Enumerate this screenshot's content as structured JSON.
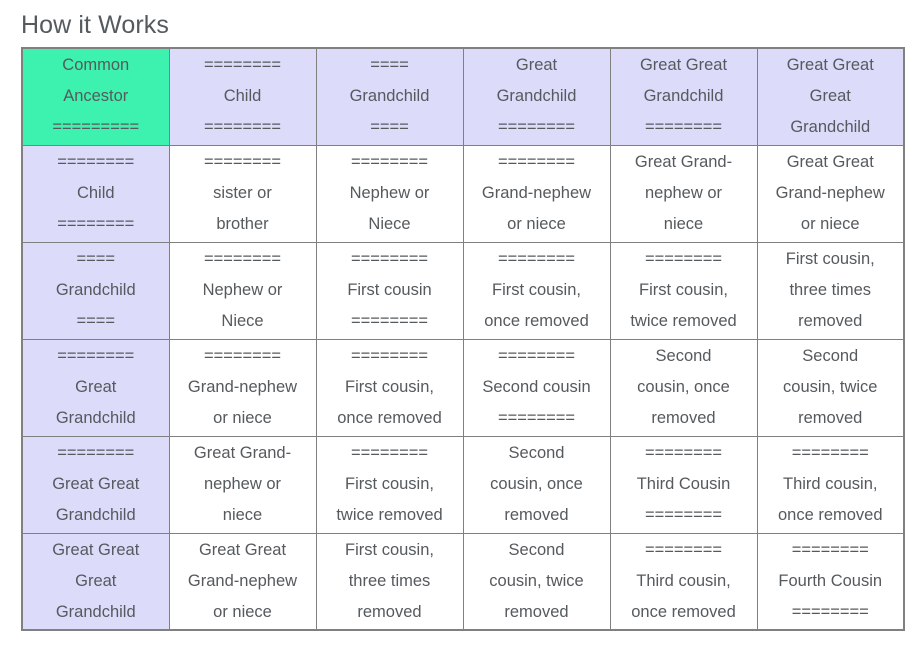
{
  "page": {
    "title": "How it Works"
  },
  "colors": {
    "anchor_cell": "#3df2ae",
    "header_cell": "#dcdcfa",
    "side_cell": "#dcdcfa",
    "body_cell": "#ffffff",
    "border": "#808080",
    "text": "#555a5e"
  },
  "table": {
    "separator_long": "========",
    "separator_anchor": "=========",
    "separator_short": "====",
    "rows": [
      [
        "Common\nAncestor\n=========",
        "========\nChild\n========",
        "====\nGrandchild\n====",
        "Great\nGrandchild\n========",
        "Great Great\nGrandchild\n========",
        "Great Great\nGreat\nGrandchild"
      ],
      [
        "========\nChild\n========",
        "========\nsister or\nbrother",
        "========\nNephew or\nNiece",
        "========\nGrand-nephew\nor niece",
        "Great Grand-\nnephew or\nniece",
        "Great Great\nGrand-nephew\nor niece"
      ],
      [
        "====\nGrandchild\n====",
        "========\nNephew or\nNiece",
        "========\nFirst cousin\n========",
        "========\nFirst cousin,\nonce removed",
        "========\nFirst cousin,\ntwice removed",
        "First cousin,\nthree times\nremoved"
      ],
      [
        "========\nGreat\nGrandchild",
        "========\nGrand-nephew\nor niece",
        "========\nFirst cousin,\nonce removed",
        "========\nSecond cousin\n========",
        "Second\ncousin, once\nremoved",
        "Second\ncousin, twice\nremoved"
      ],
      [
        "========\nGreat Great\nGrandchild",
        "Great Grand-\nnephew or\nniece",
        "========\nFirst cousin,\ntwice removed",
        "Second\ncousin, once\nremoved",
        "========\nThird Cousin\n========",
        "========\nThird cousin,\nonce removed"
      ],
      [
        "Great Great\nGreat\nGrandchild",
        "Great Great\nGrand-nephew\nor niece",
        "First cousin,\nthree times\nremoved",
        "Second\ncousin, twice\nremoved",
        "========\nThird cousin,\nonce removed",
        "========\nFourth Cousin\n========"
      ]
    ]
  }
}
